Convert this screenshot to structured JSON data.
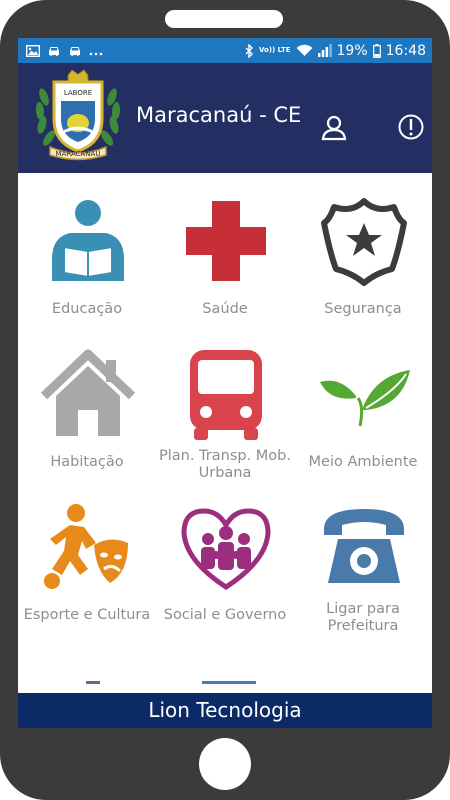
{
  "status_bar": {
    "left_icons": [
      "image-icon",
      "car-icon",
      "car-icon",
      "more-dots-icon"
    ],
    "network": "Vo)) LTE",
    "battery": "19%",
    "time": "16:48"
  },
  "header": {
    "title": "Maracanaú - CE",
    "logo_banner_top": "LABORE",
    "logo_banner_bottom": "MARACANAÚ",
    "background_color": "#232f63"
  },
  "menu": {
    "items": [
      {
        "label": "Educação",
        "icon": "reading-person-icon",
        "color": "#3a8fb4"
      },
      {
        "label": "Saúde",
        "icon": "red-cross-icon",
        "color": "#c62f37"
      },
      {
        "label": "Segurança",
        "icon": "police-badge-icon",
        "color": "#3c3c3c"
      },
      {
        "label": "Habitação",
        "icon": "house-icon",
        "color": "#a9a9a9"
      },
      {
        "label": "Plan. Transp. Mob. Urbana",
        "label_line1": "Plan. Transp. Mob.",
        "label_line2": "Urbana",
        "icon": "bus-icon",
        "color": "#d9444c"
      },
      {
        "label": "Meio Ambiente",
        "icon": "leaves-icon",
        "color": "#55a832"
      },
      {
        "label": "Esporte e Cultura",
        "icon": "soccer-theater-icon",
        "color": "#e88a1a"
      },
      {
        "label": "Social e Governo",
        "icon": "family-heart-icon",
        "color": "#9c2e7e"
      },
      {
        "label": "Ligar para Prefeitura",
        "label_line1": "Ligar para",
        "label_line2": "Prefeitura",
        "icon": "telephone-icon",
        "color": "#4a7aaa"
      }
    ]
  },
  "footer": {
    "label": "Lion Tecnologia"
  }
}
